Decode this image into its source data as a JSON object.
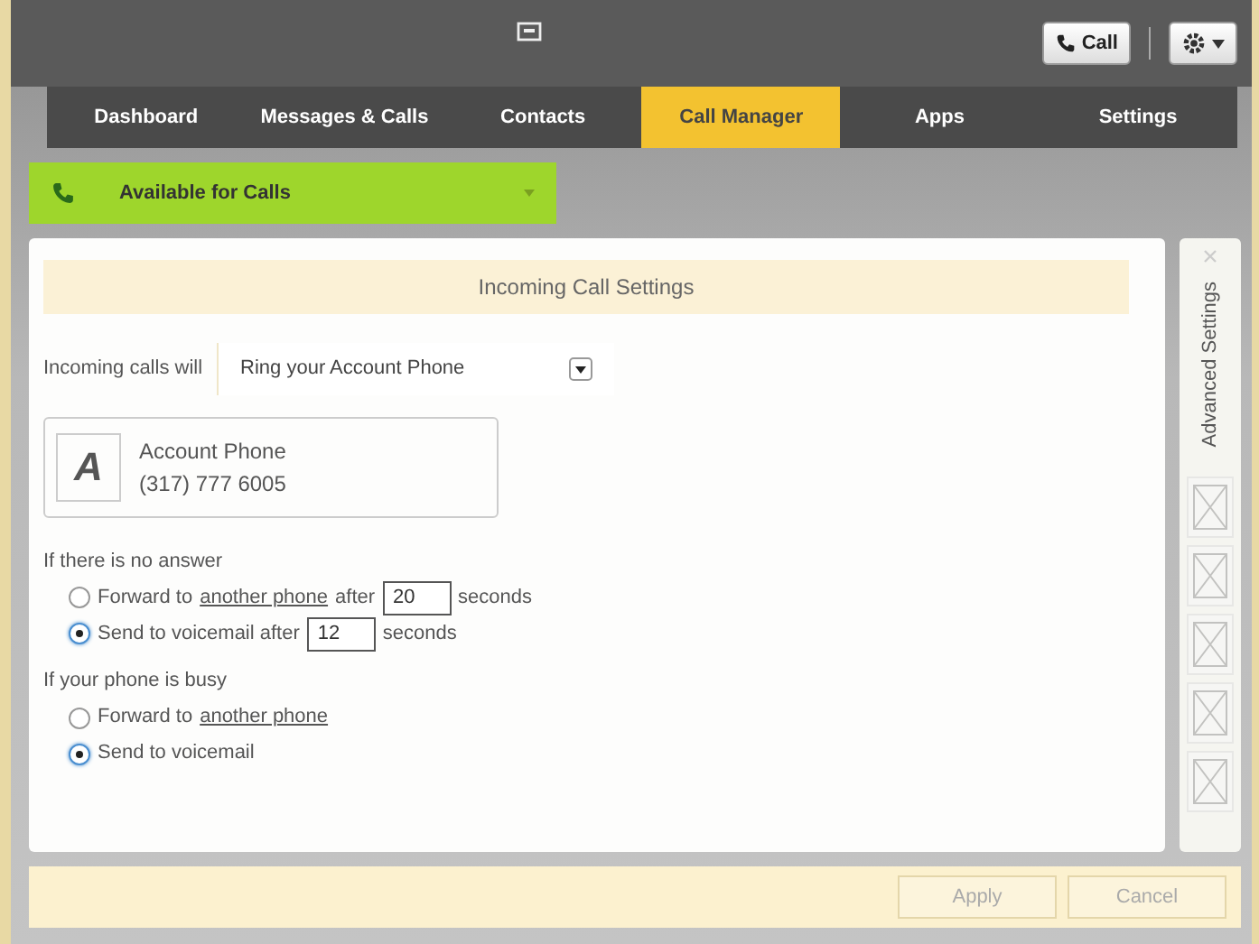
{
  "header": {
    "call_button": "Call"
  },
  "tabs": [
    {
      "label": "Dashboard",
      "selected": false
    },
    {
      "label": "Messages & Calls",
      "selected": false
    },
    {
      "label": "Contacts",
      "selected": false
    },
    {
      "label": "Call Manager",
      "selected": true
    },
    {
      "label": "Apps",
      "selected": false
    },
    {
      "label": "Settings",
      "selected": false
    }
  ],
  "status": {
    "label": "Available for Calls"
  },
  "panel": {
    "title": "Incoming Call Settings",
    "incoming_label": "Incoming calls will",
    "incoming_value": "Ring your Account Phone",
    "account": {
      "letter": "A",
      "name": "Account Phone",
      "number": "(317) 777 6005"
    },
    "groups": [
      {
        "heading": "If there is no answer",
        "options": [
          {
            "text_before": "Forward to",
            "link": "another phone",
            "text_after": "after",
            "seconds": "20",
            "unit": "seconds",
            "selected": false
          },
          {
            "text_before": "Send to voicemail after",
            "seconds": "12",
            "unit": "seconds",
            "selected": true
          }
        ]
      },
      {
        "heading": "If your phone is busy",
        "options": [
          {
            "text_before": "Forward to",
            "link": "another phone",
            "selected": false
          },
          {
            "text_before": "Send to voicemail",
            "selected": true
          }
        ]
      }
    ]
  },
  "side": {
    "title": "Advanced Settings",
    "tools": [
      {
        "disabled": true
      },
      {
        "disabled": true
      },
      {
        "disabled": true
      },
      {
        "disabled": true
      },
      {
        "disabled": true
      }
    ]
  },
  "footer": {
    "buttons": [
      {
        "label": "Apply",
        "disabled": true
      },
      {
        "label": "Cancel",
        "disabled": true
      }
    ]
  }
}
